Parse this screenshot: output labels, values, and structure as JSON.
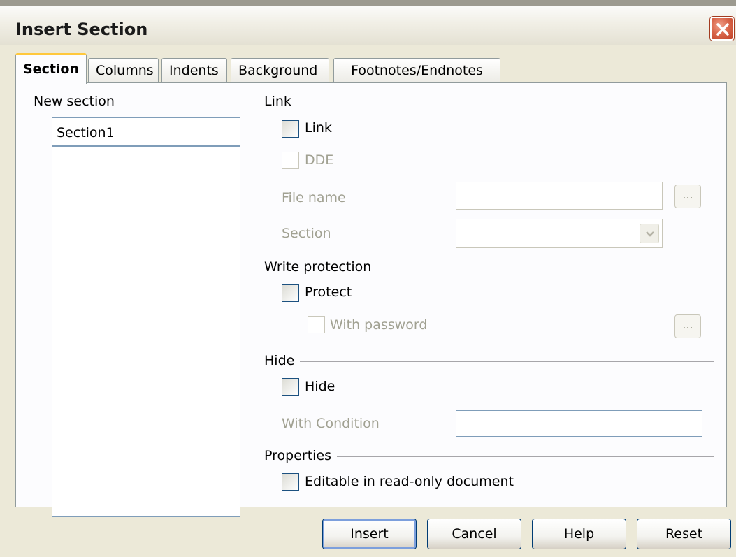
{
  "window": {
    "title": "Insert Section"
  },
  "tabs": [
    {
      "label": "Section",
      "active": true
    },
    {
      "label": "Columns",
      "active": false
    },
    {
      "label": "Indents",
      "active": false
    },
    {
      "label": "Background",
      "active": false
    },
    {
      "label": "Footnotes/Endnotes",
      "active": false
    }
  ],
  "new_section": {
    "group_label": "New section",
    "name_value": "Section1"
  },
  "link": {
    "group_label": "Link",
    "link_checkbox": {
      "label": "Link",
      "checked": false
    },
    "dde_checkbox": {
      "label": "DDE",
      "checked": false,
      "enabled": false
    },
    "file_name_label": "File name",
    "file_name_value": "",
    "browse_label": "...",
    "section_label": "Section",
    "section_value": ""
  },
  "write_protection": {
    "group_label": "Write protection",
    "protect_checkbox": {
      "label": "Protect",
      "checked": false
    },
    "with_password_checkbox": {
      "label": "With password",
      "checked": false,
      "enabled": false
    },
    "password_button_label": "..."
  },
  "hide": {
    "group_label": "Hide",
    "hide_checkbox": {
      "label": "Hide",
      "checked": false
    },
    "with_condition_label": "With Condition",
    "with_condition_value": ""
  },
  "properties": {
    "group_label": "Properties",
    "editable_checkbox": {
      "label": "Editable in read-only document",
      "checked": false
    }
  },
  "buttons": {
    "insert": "Insert",
    "cancel": "Cancel",
    "help": "Help",
    "reset": "Reset"
  },
  "colors": {
    "dialog_bg": "#ece9d8",
    "panel_bg": "#fcfcfe",
    "active_tab_accent": "#ffc83c",
    "close_button": "#d86448",
    "disabled_text": "#a1a192"
  },
  "icons": {
    "close": "close-icon",
    "dropdown": "chevron-down-icon"
  }
}
